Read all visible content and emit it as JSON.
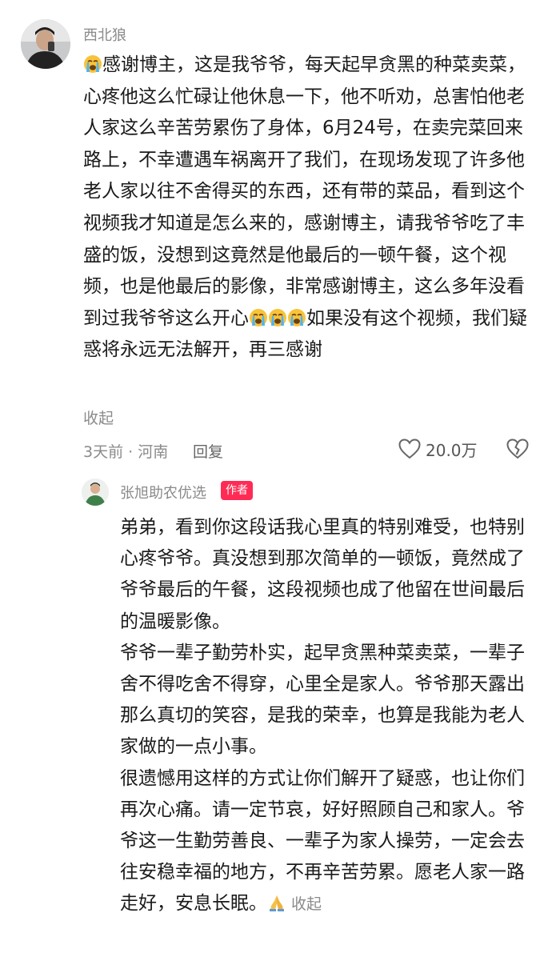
{
  "comment": {
    "username": "西北狼",
    "emoji_cry": "crying-face",
    "text_part1": "感谢博主，这是我爷爷，每天起早贪黑的种菜卖菜，心疼他这么忙碌让他休息一下，他不听劝，总害怕他老人家这么辛苦劳累伤了身体，6月24号，在卖完菜回来路上，不幸遭遇车祸离开了我们，在现场发现了许多他老人家以往不舍得买的东西，还有带的菜品，看到这个视频我才知道是怎么来的，感谢博主，请我爷爷吃了丰盛的饭，没想到这竟然是他最后的一顿午餐，这个视频，也是他最后的影像，非常感谢博主，这么多年没看到过我爷爷这么开心",
    "text_part2": "如果没有这个视频，我们疑惑将永远无法解开，再三感谢",
    "collapse_label": "收起",
    "meta": "3天前 · 河南",
    "reply_label": "回复",
    "like_count": "20.0万"
  },
  "reply": {
    "username": "张旭助农优选",
    "badge": "作者",
    "paragraphs": [
      "弟弟，看到你这段话我心里真的特别难受，也特别心疼爷爷。真没想到那次简单的一顿饭，竟然成了爷爷最后的午餐，这段视频也成了他留在世间最后的温暖影像。",
      "爷爷一辈子勤劳朴实，起早贪黑种菜卖菜，一辈子舍不得吃舍不得穿，心里全是家人。爷爷那天露出那么真切的笑容，是我的荣幸，也算是我能为老人家做的一点小事。"
    ],
    "last_paragraph": "很遗憾用这样的方式让你们解开了疑惑，也让你们再次心痛。请一定节哀，好好照顾自己和家人。爷爷这一生勤劳善良、一辈子为家人操劳，一定会去往安稳幸福的地方，不再辛苦劳累。愿老人家一路走好，安息长眠。",
    "emoji_pray": "pray",
    "collapse_label": "收起"
  },
  "colors": {
    "badge": "#fe2c55",
    "muted": "#8a8a8a"
  }
}
